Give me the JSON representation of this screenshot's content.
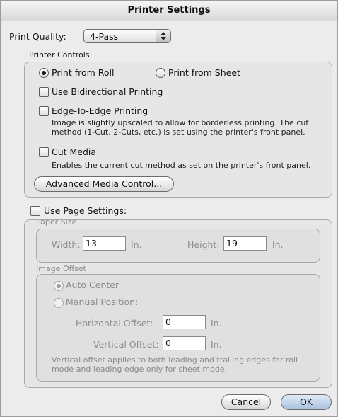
{
  "window": {
    "title": "Printer Settings"
  },
  "print_quality": {
    "label": "Print Quality:",
    "value": "4-Pass"
  },
  "printer_controls": {
    "title": "Printer Controls:",
    "print_from_roll": "Print from Roll",
    "print_from_sheet": "Print from Sheet",
    "bidirectional": "Use Bidirectional Printing",
    "edge_to_edge": "Edge-To-Edge Printing",
    "edge_desc_1": "Image is slightly upscaled to allow for borderless printing.  The cut",
    "edge_desc_2": "method (1-Cut, 2-Cuts, etc.) is set using the printer's front panel.",
    "cut_media": "Cut Media",
    "cut_desc": "Enables the current cut method as set on the printer's front panel.",
    "advanced_button": "Advanced Media Control..."
  },
  "page_settings": {
    "label": "Use Page Settings:",
    "paper_size": {
      "title": "Paper Size",
      "width_label": "Width:",
      "width_value": "13",
      "width_unit": "In.",
      "height_label": "Height:",
      "height_value": "19",
      "height_unit": "In."
    },
    "image_offset": {
      "title": "Image Offset",
      "auto_center": "Auto Center",
      "manual_position": "Manual Position:",
      "horizontal_label": "Horizontal Offset:",
      "horizontal_value": "0",
      "horizontal_unit": "In.",
      "vertical_label": "Vertical Offset:",
      "vertical_value": "0",
      "vertical_unit": "In.",
      "note_1": "Vertical offset applies to both leading and trailing edges for roll",
      "note_2": "mode and leading edge only for sheet mode."
    }
  },
  "buttons": {
    "cancel": "Cancel",
    "ok": "OK"
  }
}
